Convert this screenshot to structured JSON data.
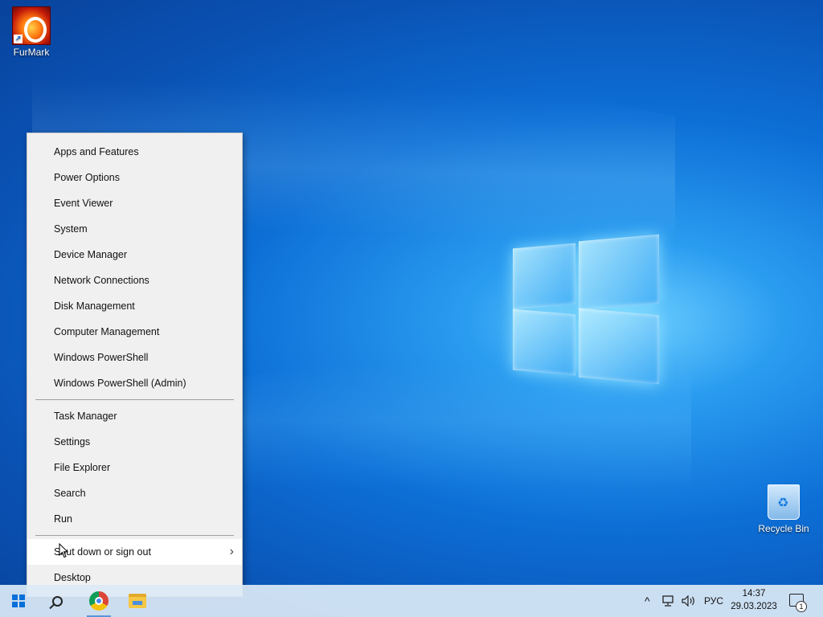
{
  "desktop": {
    "icons": [
      {
        "label": "FurMark",
        "icon": "furmark-icon"
      },
      {
        "label": "Recycle Bin",
        "icon": "recycle-bin-icon"
      }
    ]
  },
  "context_menu": {
    "group1": [
      "Apps and Features",
      "Power Options",
      "Event Viewer",
      "System",
      "Device Manager",
      "Network Connections",
      "Disk Management",
      "Computer Management",
      "Windows PowerShell",
      "Windows PowerShell (Admin)"
    ],
    "group2": [
      "Task Manager",
      "Settings",
      "File Explorer",
      "Search",
      "Run"
    ],
    "group3": [
      {
        "label": "Shut down or sign out",
        "has_submenu": true,
        "submenu_icon": "chevron-right-icon"
      },
      {
        "label": "Desktop"
      }
    ]
  },
  "taskbar": {
    "start_icon": "windows-start-icon",
    "search_icon": "search-icon",
    "pinned": [
      "chrome-icon",
      "file-explorer-icon"
    ],
    "tray": {
      "overflow_icon": "chevron-up-icon",
      "network_icon": "network-icon",
      "volume_icon": "speaker-icon",
      "language": "РУС",
      "time": "14:37",
      "date": "29.03.2023",
      "notification_icon": "notification-center-icon",
      "notification_count": "1"
    }
  },
  "colors": {
    "menu_bg": "#f0f0f0",
    "menu_hover": "#ffffff",
    "desktop_blue": "#0d6fd6",
    "taskbar_bg": "#dceaf6"
  }
}
